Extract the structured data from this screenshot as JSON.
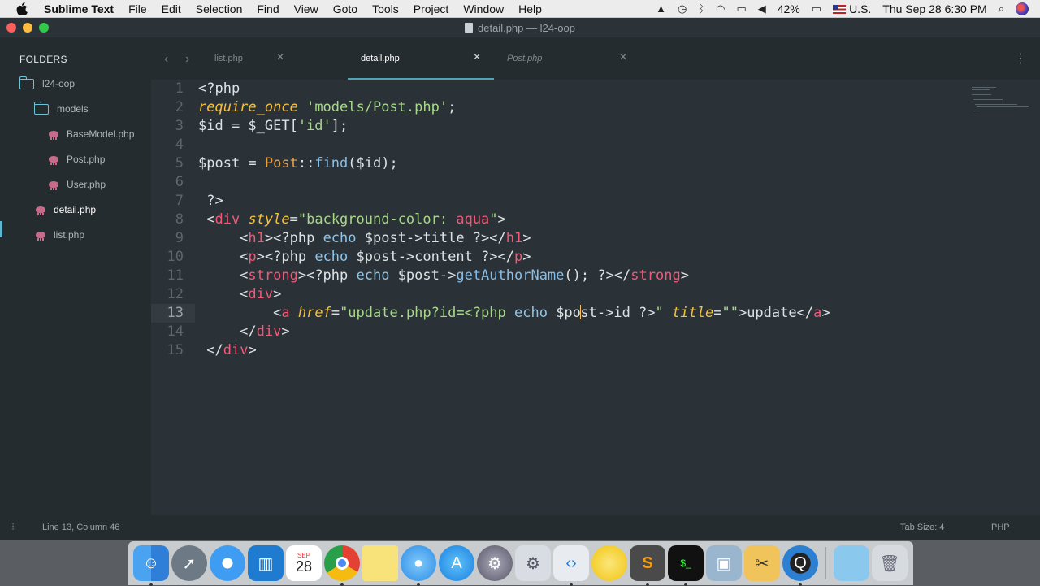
{
  "menubar": {
    "app_name": "Sublime Text",
    "items": [
      "File",
      "Edit",
      "Selection",
      "Find",
      "View",
      "Goto",
      "Tools",
      "Project",
      "Window",
      "Help"
    ],
    "battery": "42%",
    "input_source": "U.S.",
    "clock": "Thu Sep 28  6:30 PM"
  },
  "window": {
    "title": "detail.php — l24-oop"
  },
  "sidebar": {
    "header": "FOLDERS",
    "tree": [
      {
        "label": "l24-oop",
        "type": "folder"
      },
      {
        "label": "models",
        "type": "folder"
      },
      {
        "label": "BaseModel.php",
        "type": "file"
      },
      {
        "label": "Post.php",
        "type": "file"
      },
      {
        "label": "User.php",
        "type": "file"
      },
      {
        "label": "detail.php",
        "type": "file",
        "selected": true
      },
      {
        "label": "list.php",
        "type": "file"
      }
    ]
  },
  "tabs": [
    {
      "label": "list.php",
      "active": false,
      "italic": false
    },
    {
      "label": "detail.php",
      "active": true,
      "italic": false
    },
    {
      "label": "Post.php",
      "active": false,
      "italic": true
    }
  ],
  "editor": {
    "line_numbers": [
      "1",
      "2",
      "3",
      "4",
      "5",
      "6",
      "7",
      "8",
      "9",
      "10",
      "11",
      "12",
      "13",
      "14",
      "15"
    ],
    "current_line": 13
  },
  "statusbar": {
    "position": "Line 13, Column 46",
    "tab_size": "Tab Size: 4",
    "syntax": "PHP"
  },
  "dock": {
    "apps": [
      "finder-icon",
      "launchpad-icon",
      "safari-icon",
      "trello-icon",
      "calendar-icon",
      "chrome-icon",
      "notes-icon",
      "messages-icon",
      "app-store-icon",
      "system-preferences-icon",
      "utility-icon",
      "vscode-icon",
      "sketch-icon",
      "sublime-text-icon",
      "terminal-icon",
      "preview-icon",
      "scissors-icon",
      "quicktime-icon",
      "downloads-folder-icon",
      "trash-icon"
    ],
    "calendar_day": "28",
    "calendar_month": "SEP"
  }
}
